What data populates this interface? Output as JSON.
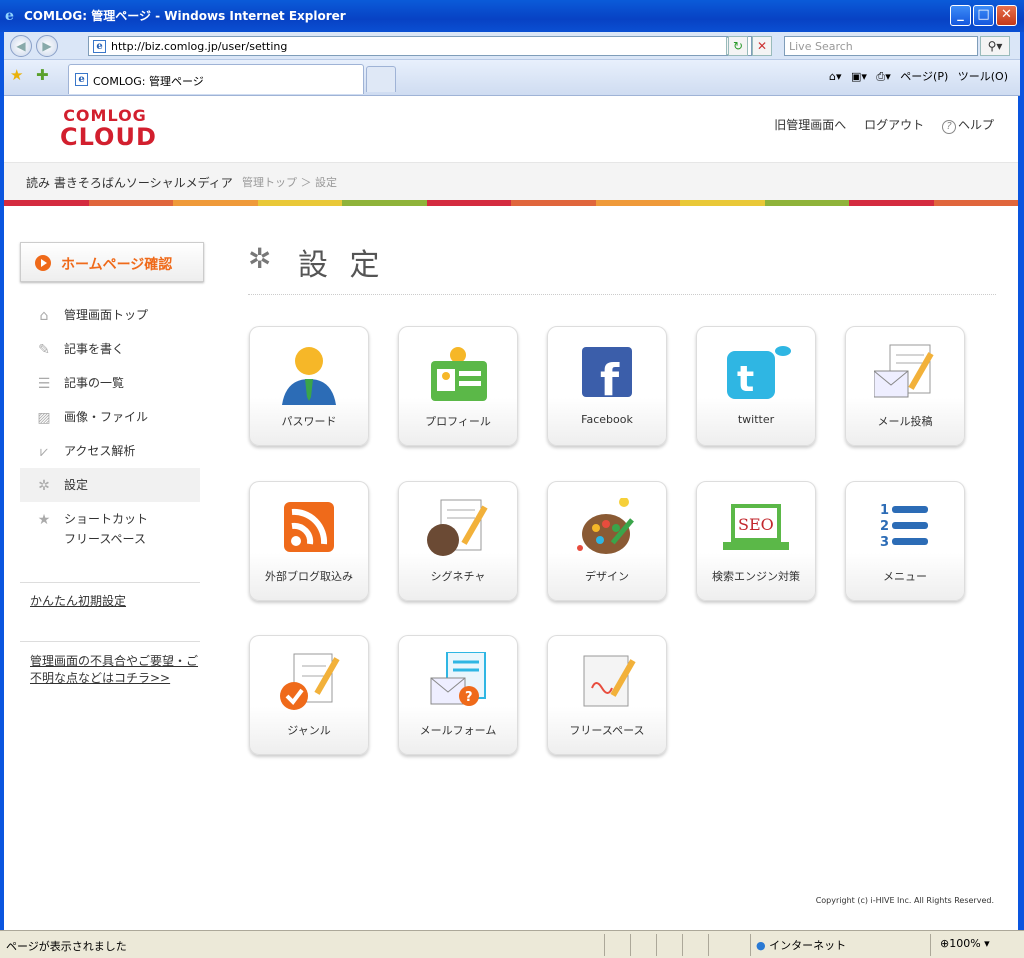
{
  "window": {
    "title": "COMLOG: 管理ページ - Windows Internet Explorer"
  },
  "browser": {
    "url": "http://biz.comlog.jp/user/setting",
    "search_placeholder": "Live Search",
    "tab_label": "COMLOG: 管理ページ",
    "page_menu": "ページ(P)",
    "tools_menu": "ツール(O)"
  },
  "header": {
    "logo_top": "COMLOG",
    "logo_bottom": "CLOUD",
    "links": [
      "旧管理画面へ",
      "ログアウト",
      "ヘルプ"
    ]
  },
  "breadcrumb": {
    "site": "読み 書きそろばんソーシャルメディア",
    "path": "管理トップ ＞ 設定"
  },
  "colors": [
    "#d42b3f",
    "#e0663c",
    "#ef9a3a",
    "#e9c838",
    "#8fb33a",
    "#d42b3f",
    "#e0663c",
    "#ef9a3a",
    "#e9c838",
    "#8fb33a",
    "#d42b3f",
    "#e0663c"
  ],
  "sidebar": {
    "homepage_button": "ホームページ確認",
    "items": [
      {
        "label": "管理画面トップ",
        "icon": "home-icon"
      },
      {
        "label": "記事を書く",
        "icon": "pencil-icon"
      },
      {
        "label": "記事の一覧",
        "icon": "list-icon"
      },
      {
        "label": "画像・ファイル",
        "icon": "image-icon"
      },
      {
        "label": "アクセス解析",
        "icon": "chart-icon"
      },
      {
        "label": "設定",
        "icon": "gear-icon"
      },
      {
        "label": "ショートカット",
        "icon": "star-icon"
      }
    ],
    "shortcut_sub": "フリースペース",
    "setup_link": "かんたん初期設定",
    "feedback_link_1": "管理画面の不具合やご要望・ご",
    "feedback_link_2": "不明な点などはコチラ>>"
  },
  "main": {
    "title": "設 定",
    "tiles": [
      "パスワード",
      "プロフィール",
      "Facebook",
      "twitter",
      "メール投稿",
      "外部ブログ取込み",
      "シグネチャ",
      "デザイン",
      "検索エンジン対策",
      "メニュー",
      "ジャンル",
      "メールフォーム",
      "フリースペース"
    ]
  },
  "footer": {
    "copyright": "Copyright (c) i-HIVE Inc. All Rights Reserved."
  },
  "status": {
    "message": "ページが表示されました",
    "zone": "インターネット",
    "zoom": "100%"
  }
}
